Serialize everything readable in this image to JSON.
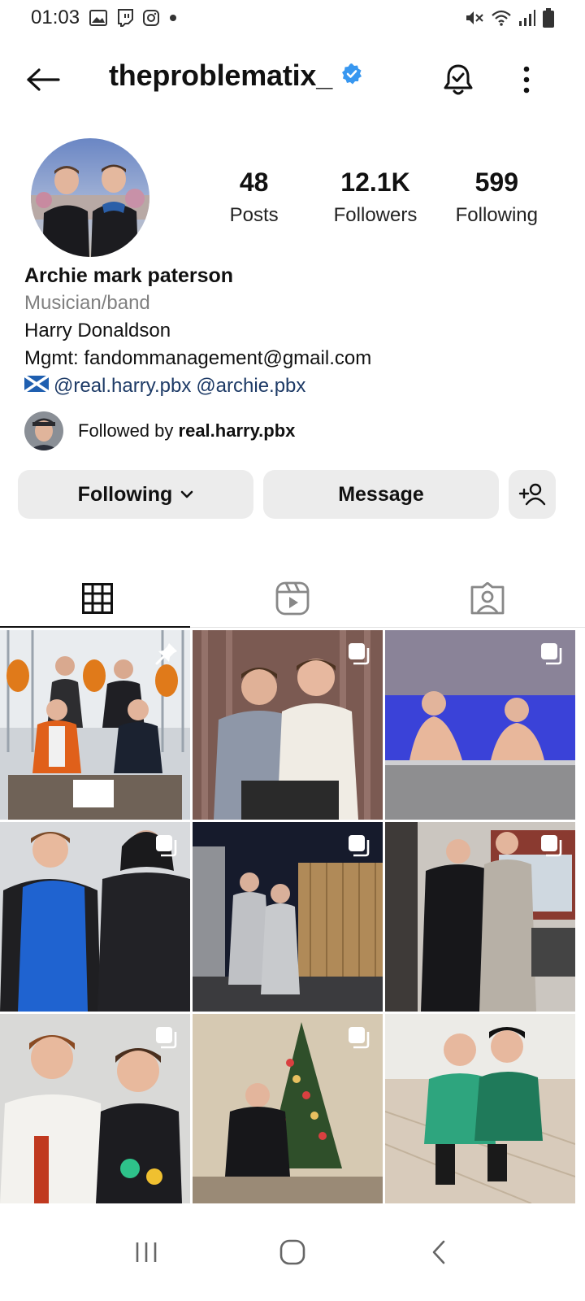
{
  "status_bar": {
    "time": "01:03",
    "left_icons": [
      "gallery-icon",
      "twitch-icon",
      "instagram-icon",
      "dot-icon"
    ],
    "right_icons": [
      "mute-icon",
      "wifi-icon",
      "signal-icon",
      "battery-icon"
    ]
  },
  "header": {
    "username": "theproblematix_",
    "verified": true
  },
  "profile": {
    "stats": [
      {
        "value": "48",
        "label": "Posts"
      },
      {
        "value": "12.1K",
        "label": "Followers"
      },
      {
        "value": "599",
        "label": "Following"
      }
    ],
    "name": "Archie mark paterson",
    "category": "Musician/band",
    "bio_lines": [
      "Harry Donaldson",
      "Mgmt: fandommanagement@gmail.com"
    ],
    "flag": "🏴",
    "links": [
      "@real.harry.pbx",
      "@archie.pbx"
    ],
    "followed_by_prefix": "Followed by",
    "followed_by_name": "real.harry.pbx"
  },
  "actions": {
    "following_label": "Following",
    "message_label": "Message"
  },
  "tabs": [
    "posts-grid-tab",
    "reels-tab",
    "tagged-tab"
  ],
  "colors": {
    "verified": "#3897f0",
    "link": "#1d3a66",
    "button_bg": "#ececec"
  },
  "posts": [
    {
      "type": "pinned"
    },
    {
      "type": "carousel"
    },
    {
      "type": "carousel"
    },
    {
      "type": "carousel"
    },
    {
      "type": "carousel"
    },
    {
      "type": "carousel"
    },
    {
      "type": "carousel"
    },
    {
      "type": "carousel"
    },
    {
      "type": "none"
    }
  ]
}
